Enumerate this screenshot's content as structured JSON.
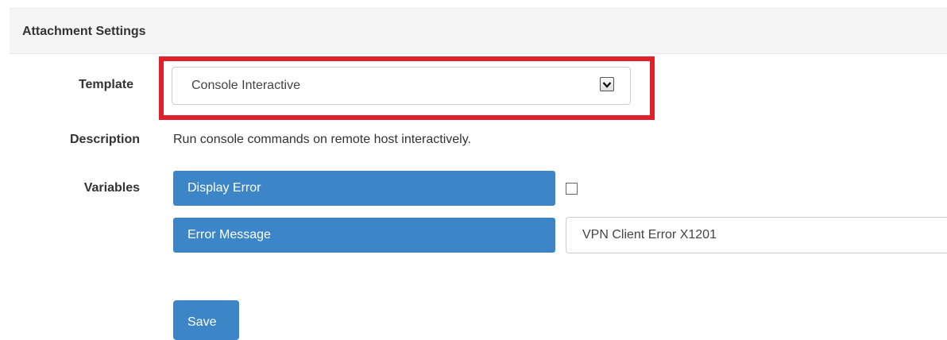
{
  "panel": {
    "title": "Attachment Settings"
  },
  "form": {
    "template_label": "Template",
    "template_value": "Console Interactive",
    "description_label": "Description",
    "description_text": "Run console commands on remote host interactively.",
    "variables_label": "Variables",
    "variables": [
      {
        "name": "Display Error",
        "type": "checkbox",
        "checked": false
      },
      {
        "name": "Error Message",
        "type": "text",
        "value": "VPN Client Error X1201"
      }
    ]
  },
  "actions": {
    "save_label": "Save"
  },
  "colors": {
    "accent": "#3c86c8",
    "highlight": "#e0202a",
    "header_bg": "#f5f5f5"
  },
  "icons": {
    "select_arrow": "chevron-down-icon"
  }
}
